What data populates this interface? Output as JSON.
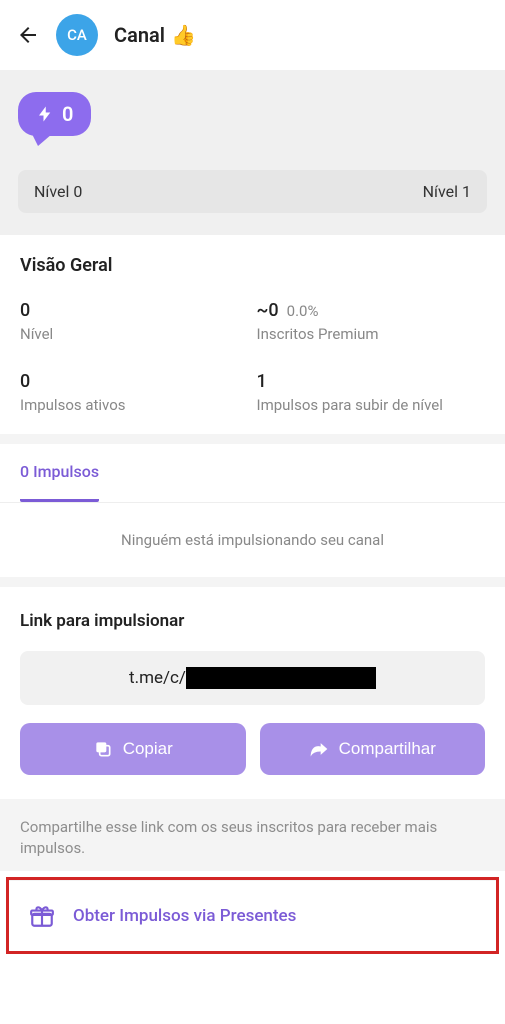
{
  "header": {
    "avatar_initials": "CA",
    "title": "Canal",
    "emoji": "👍"
  },
  "hero": {
    "boost_count": "0",
    "level_left": "Nível 0",
    "level_right": "Nível 1"
  },
  "overview": {
    "title": "Visão Geral",
    "stats": {
      "level_value": "0",
      "level_label": "Nível",
      "premium_value": "~0",
      "premium_pct": "0.0%",
      "premium_label": "Inscritos Premium",
      "active_value": "0",
      "active_label": "Impulsos ativos",
      "needed_value": "1",
      "needed_label": "Impulsos para subir de nível"
    }
  },
  "tabs": {
    "boosts_label": "0 Impulsos",
    "empty_msg": "Ninguém está impulsionando seu canal"
  },
  "link": {
    "title": "Link para impulsionar",
    "url_prefix": "t.me/c/",
    "copy_label": "Copiar",
    "share_label": "Compartilhar"
  },
  "footer": {
    "note": "Compartilhe esse link com os seus inscritos para receber mais impulsos.",
    "gift_label": "Obter Impulsos via Presentes"
  }
}
